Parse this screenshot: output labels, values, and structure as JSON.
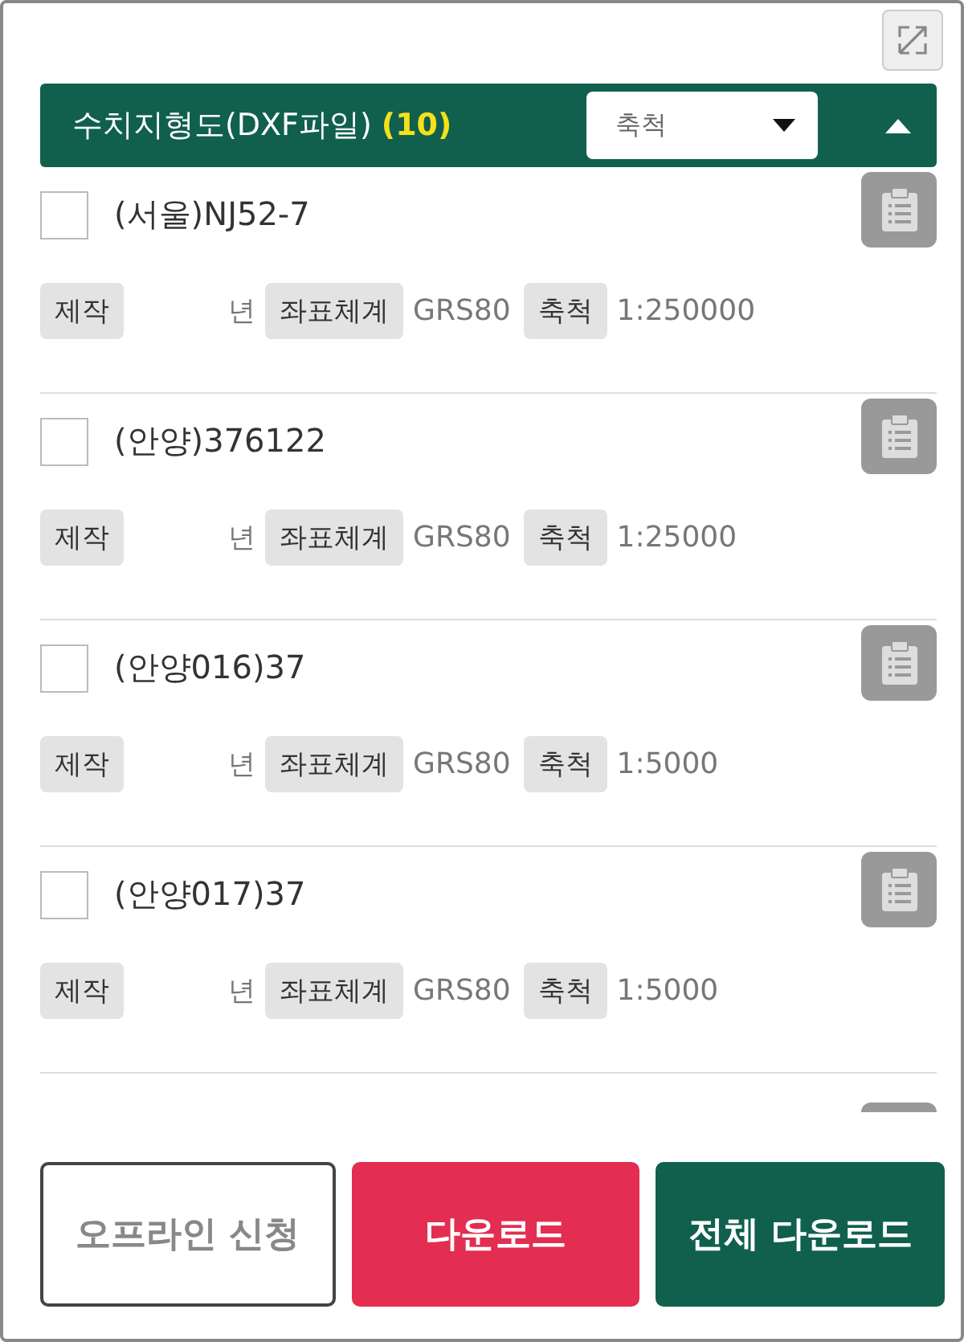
{
  "header": {
    "title": "수치지형도(DXF파일)",
    "count": "(10)",
    "scale_select": {
      "value": "축척"
    },
    "expanded": true
  },
  "items": [
    {
      "name": "(서울)NJ52-7",
      "checked": false,
      "made_label": "제작",
      "year": "년",
      "crs_label": "좌표체계",
      "crs": "GRS80",
      "scale_label": "축척",
      "scale": "1:250000"
    },
    {
      "name": "(안양)376122",
      "checked": false,
      "made_label": "제작",
      "year": "년",
      "crs_label": "좌표체계",
      "crs": "GRS80",
      "scale_label": "축척",
      "scale": "1:25000"
    },
    {
      "name": "(안양016)37",
      "checked": false,
      "made_label": "제작",
      "year": "년",
      "crs_label": "좌표체계",
      "crs": "GRS80",
      "scale_label": "축척",
      "scale": "1:5000"
    },
    {
      "name": "(안양017)37",
      "checked": false,
      "made_label": "제작",
      "year": "년",
      "crs_label": "좌표체계",
      "crs": "GRS80",
      "scale_label": "축척",
      "scale": "1:5000"
    }
  ],
  "buttons": [
    {
      "label": "오프라인 신청",
      "kind": "outline"
    },
    {
      "label": "다운로드",
      "kind": "danger"
    },
    {
      "label": "전체 다운로드",
      "kind": "primary"
    }
  ]
}
